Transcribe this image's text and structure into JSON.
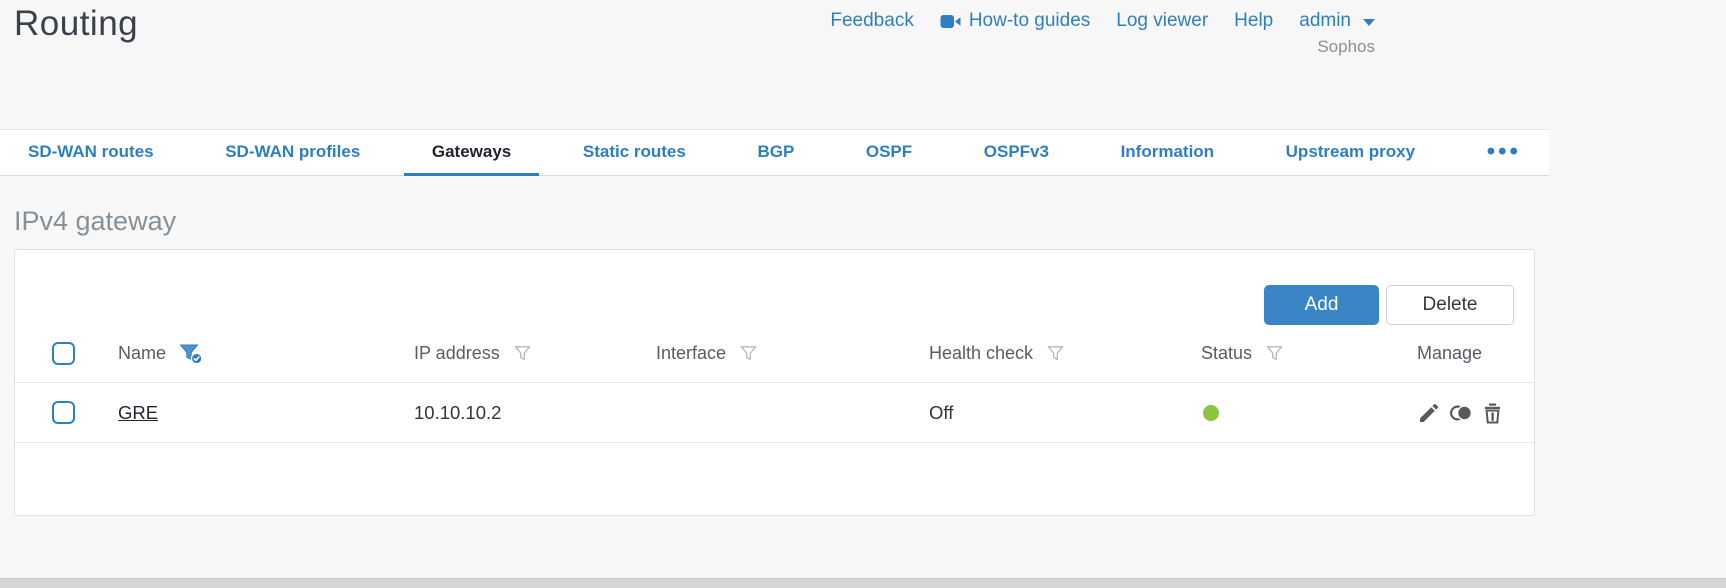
{
  "colors": {
    "accent_blue": "#2e7fc2",
    "add_button_blue": "#3a85c6",
    "status_green": "#8bc53f",
    "manage_icon_gray": "#595959"
  },
  "header": {
    "title": "Routing",
    "links": [
      "Feedback",
      "How-to guides",
      "Log viewer",
      "Help"
    ],
    "user_menu": "admin",
    "brand": "Sophos"
  },
  "tabs": {
    "items": [
      {
        "label": "SD-WAN routes",
        "active": false
      },
      {
        "label": "SD-WAN profiles",
        "active": false
      },
      {
        "label": "Gateways",
        "active": true
      },
      {
        "label": "Static routes",
        "active": false
      },
      {
        "label": "BGP",
        "active": false
      },
      {
        "label": "OSPF",
        "active": false
      },
      {
        "label": "OSPFv3",
        "active": false
      },
      {
        "label": "Information",
        "active": false
      },
      {
        "label": "Upstream proxy",
        "active": false
      }
    ],
    "more_icon": "•••"
  },
  "section": {
    "title": "IPv4 gateway"
  },
  "toolbar": {
    "add_label": "Add",
    "delete_label": "Delete"
  },
  "table": {
    "columns": [
      {
        "label": "Name",
        "filter": "active"
      },
      {
        "label": "IP address",
        "filter": "inactive"
      },
      {
        "label": "Interface",
        "filter": "inactive"
      },
      {
        "label": "Health check",
        "filter": "inactive"
      },
      {
        "label": "Status",
        "filter": "inactive"
      },
      {
        "label": "Manage",
        "filter": "none"
      }
    ],
    "rows": [
      {
        "name": "GRE",
        "ip_address": "10.10.10.2",
        "interface": "",
        "health_check": "Off",
        "status": "green",
        "actions": [
          "edit",
          "clone",
          "delete"
        ]
      }
    ]
  }
}
